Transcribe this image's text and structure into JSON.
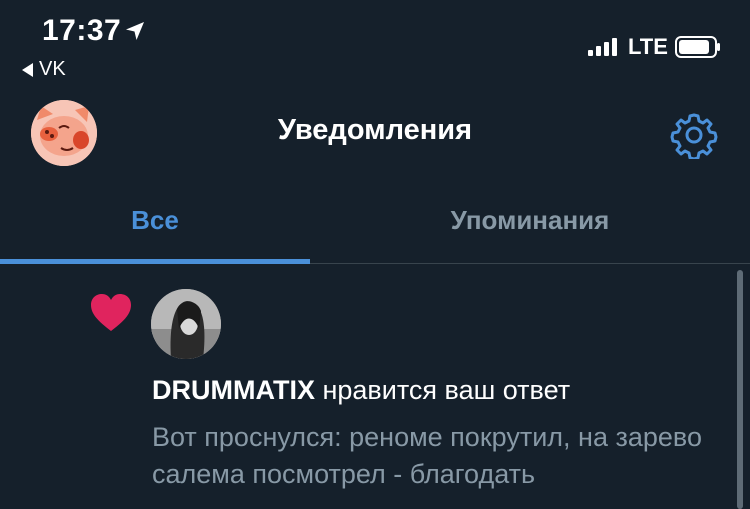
{
  "status_bar": {
    "time": "17:37",
    "back_app": "VK",
    "carrier": "LTE",
    "icons": [
      "location-arrow-icon",
      "signal-bars-icon",
      "battery-icon"
    ]
  },
  "header": {
    "title": "Уведомления",
    "avatar_icon": "pig-avatar",
    "settings_icon": "gear-icon"
  },
  "tabs": [
    {
      "label": "Все",
      "active": true
    },
    {
      "label": "Упоминания",
      "active": false
    }
  ],
  "notification": {
    "icon": "heart-icon",
    "username": "DRUMMATIX",
    "action": " нравится ваш ответ",
    "preview": "Вот проснулся: реноме покрутил, на зарево салема посмотрел - благодать"
  },
  "colors": {
    "background": "#15202b",
    "accent": "#4a90d9",
    "muted_text": "#8899a6",
    "heart": "#e0245e",
    "divider": "#38444d"
  }
}
